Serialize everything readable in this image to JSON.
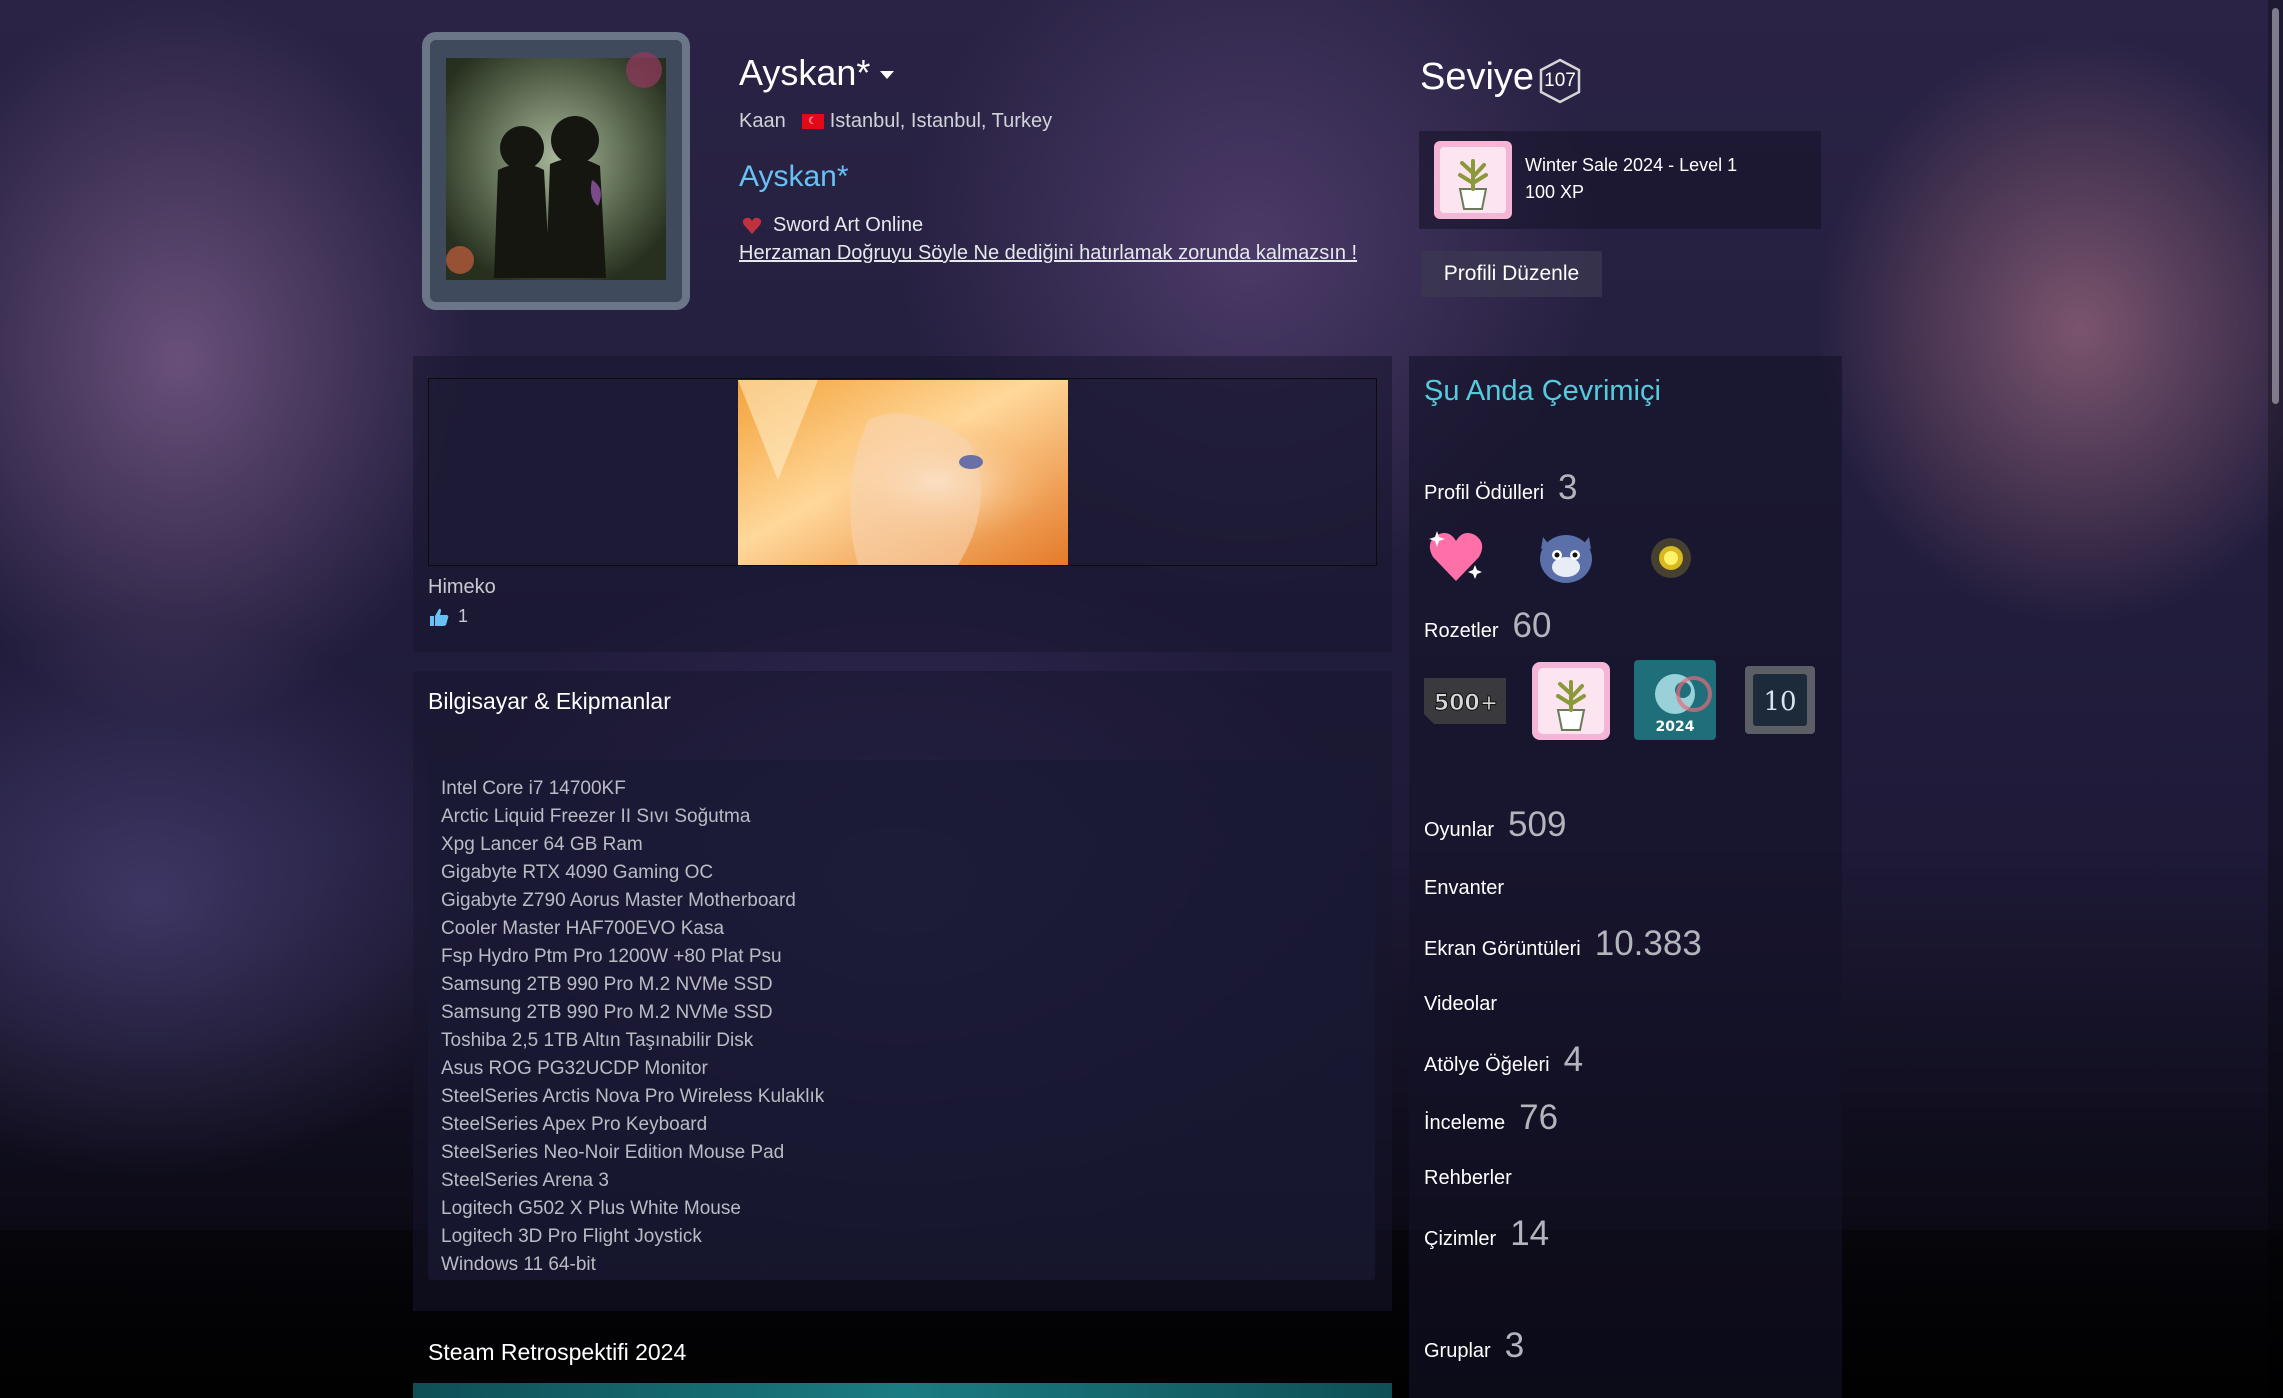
{
  "profile": {
    "persona_name": "Ayskan*",
    "real_name": "Kaan",
    "location": "Istanbul, Istanbul, Turkey",
    "custom_name": "Ayskan*",
    "favorite_game": "Sword Art Online",
    "summary": "Herzaman Doğruyu Söyle Ne dediğini hatırlamak zorunda kalmazsın !"
  },
  "level": {
    "label": "Seviye",
    "value": "107"
  },
  "favorite_badge": {
    "name": "Winter Sale 2024 - Level 1",
    "xp": "100 XP"
  },
  "edit_profile_label": "Profili Düzenle",
  "artwork_showcase": {
    "title": "Himeko",
    "likes": "1"
  },
  "equipment": {
    "title": "Bilgisayar & Ekipmanlar",
    "items": [
      "Intel Core i7 14700KF",
      "Arctic Liquid Freezer II Sıvı Soğutma",
      "Xpg Lancer 64 GB Ram",
      "Gigabyte RTX 4090 Gaming OC",
      "Gigabyte Z790 Aorus Master Motherboard",
      "Cooler Master HAF700EVO Kasa",
      "Fsp Hydro Ptm Pro 1200W +80 Plat Psu",
      "Samsung 2TB 990 Pro M.2 NVMe SSD",
      "Samsung 2TB 990 Pro M.2 NVMe SSD",
      "Toshiba 2,5 1TB Altın Taşınabilir Disk",
      "Asus ROG PG32UCDP Monitor",
      "SteelSeries Arctis Nova Pro Wireless Kulaklık",
      "SteelSeries Apex Pro Keyboard",
      "SteelSeries Neo-Noir Edition Mouse Pad",
      "SteelSeries Arena 3",
      "Logitech G502 X Plus White Mouse",
      "Logitech 3D Pro Flight Joystick",
      "Windows 11 64-bit"
    ]
  },
  "retrospective_title": "Steam Retrospektifi 2024",
  "sidebar": {
    "online_status": "Şu Anda Çevrimiçi",
    "awards": {
      "label": "Profil Ödülleri",
      "count": "3",
      "icons": [
        "heart-award-icon",
        "tiger-award-icon",
        "sun-award-icon"
      ]
    },
    "badges": {
      "label": "Rozetler",
      "count": "60",
      "items": [
        "500+",
        "",
        "2024",
        "10"
      ]
    },
    "games": {
      "label": "Oyunlar",
      "count": "509"
    },
    "inventory": {
      "label": "Envanter"
    },
    "screenshots": {
      "label": "Ekran Görüntüleri",
      "count": "10.383"
    },
    "videos": {
      "label": "Videolar"
    },
    "workshop": {
      "label": "Atölye Öğeleri",
      "count": "4"
    },
    "reviews": {
      "label": "İnceleme",
      "count": "76"
    },
    "guides": {
      "label": "Rehberler"
    },
    "artwork": {
      "label": "Çizimler",
      "count": "14"
    },
    "groups": {
      "label": "Gruplar",
      "count": "3"
    }
  },
  "colors": {
    "accent_blue": "#67c1f5",
    "online_cyan": "#57cbde",
    "retro_teal": "#1a7c82"
  }
}
